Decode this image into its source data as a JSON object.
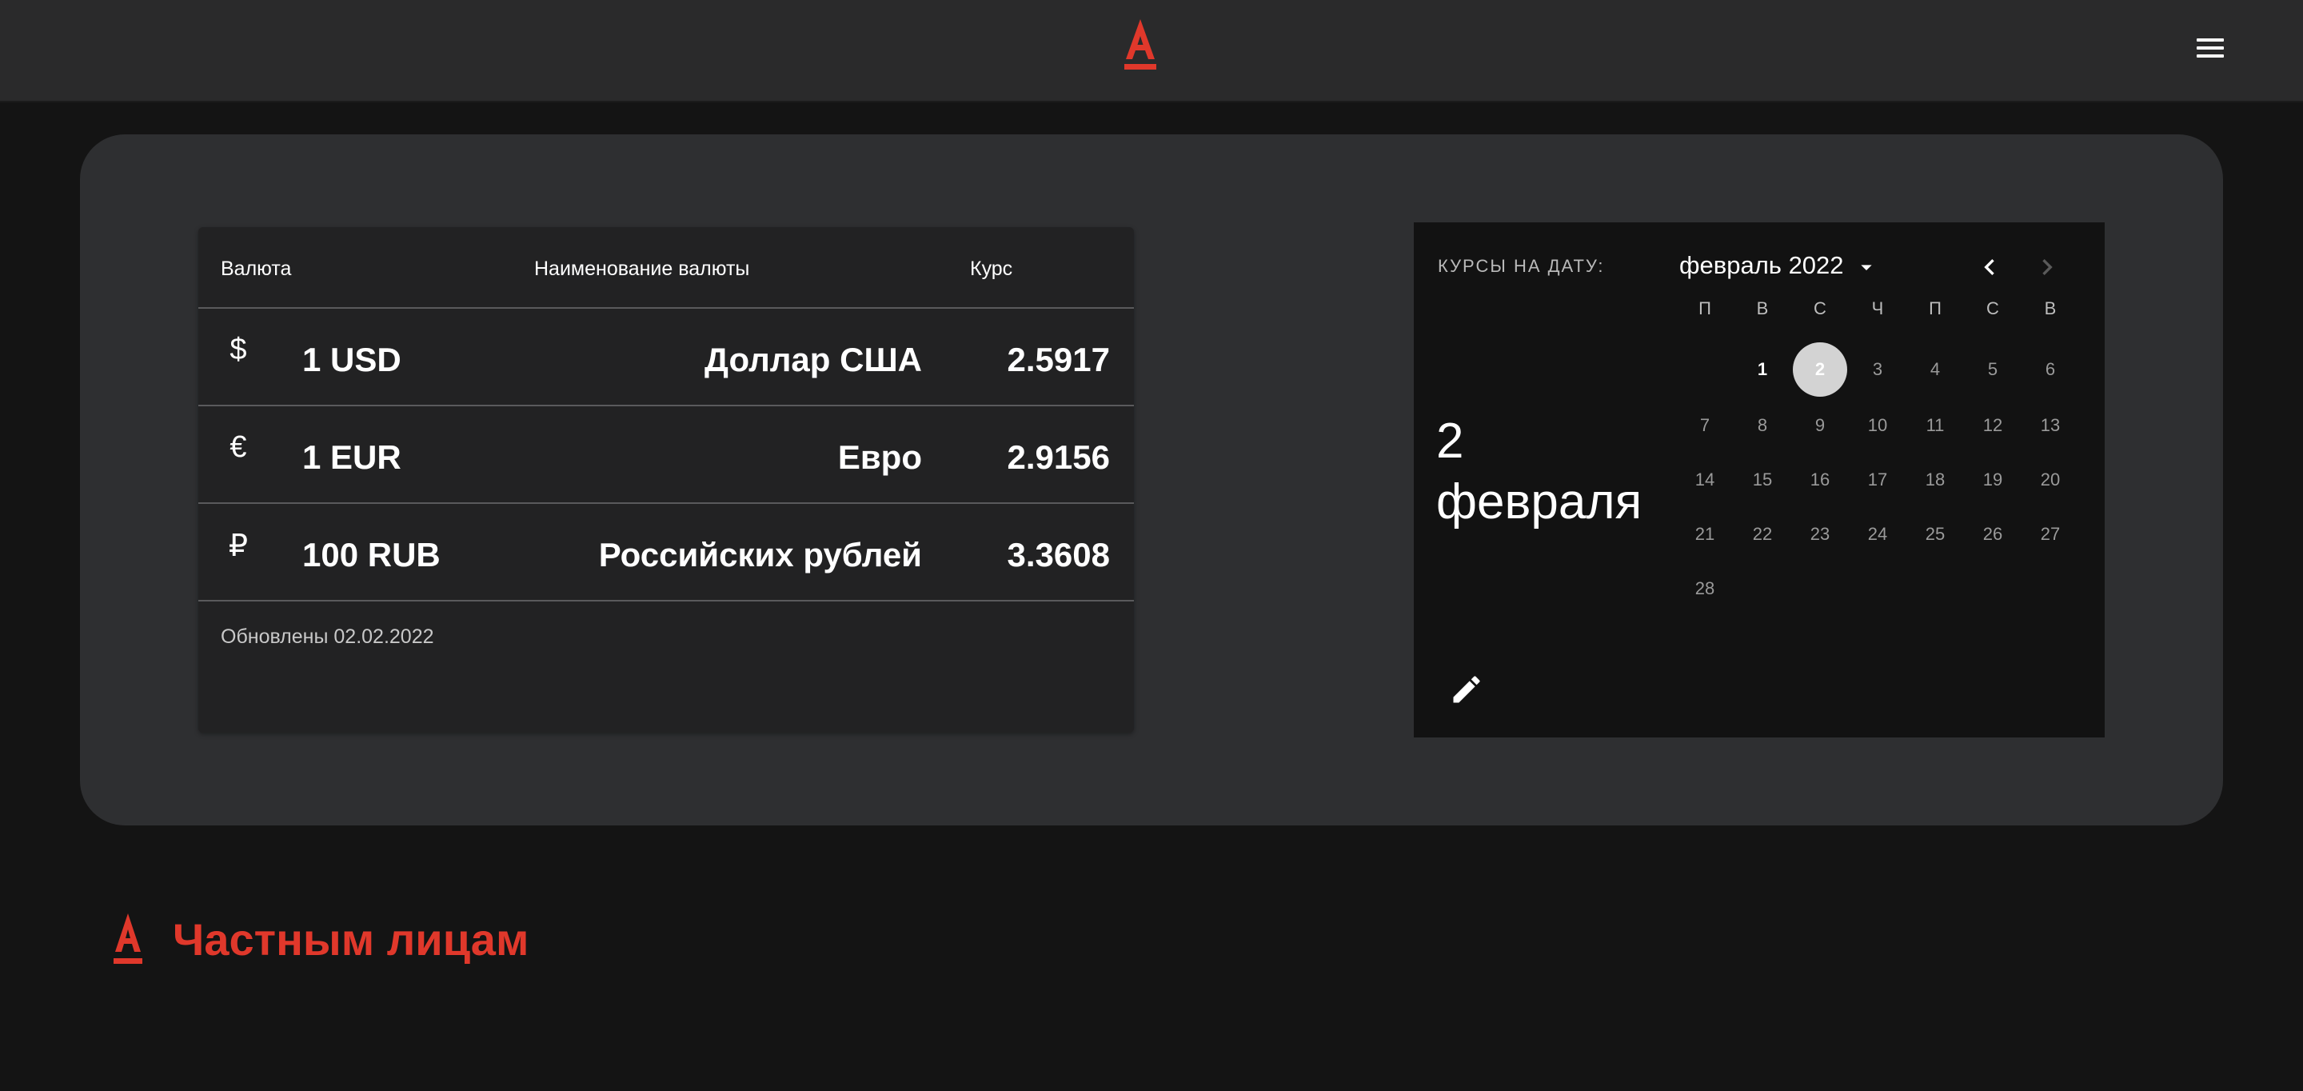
{
  "colors": {
    "brand": "#e0382b",
    "background": "#141414",
    "card": "#2e2f31",
    "table": "#222223",
    "picker": "#121212"
  },
  "header": {
    "logo_icon": "alfa-bank-logo-icon",
    "menu_icon": "hamburger-menu-icon"
  },
  "rates": {
    "headers": {
      "currency": "Валюта",
      "name": "Наименование валюты",
      "rate": "Курс"
    },
    "rows": [
      {
        "symbol": "$",
        "code": "1 USD",
        "name": "Доллар США",
        "value": "2.5917"
      },
      {
        "symbol": "€",
        "code": "1 EUR",
        "name": "Евро",
        "value": "2.9156"
      },
      {
        "symbol": "₽",
        "code": "100 RUB",
        "name": "Российских рублей",
        "value": "3.3608"
      }
    ],
    "updated": "Обновлены 02.02.2022"
  },
  "picker": {
    "label": "КУРСЫ НА ДАТУ:",
    "selected_date": "2 февраля",
    "month": "февраль",
    "year": "2022",
    "edit_icon": "pencil-icon",
    "weekdays": [
      "П",
      "В",
      "С",
      "Ч",
      "П",
      "С",
      "В"
    ],
    "weeks": [
      [
        "",
        "1",
        "2",
        "3",
        "4",
        "5",
        "6"
      ],
      [
        "7",
        "8",
        "9",
        "10",
        "11",
        "12",
        "13"
      ],
      [
        "14",
        "15",
        "16",
        "17",
        "18",
        "19",
        "20"
      ],
      [
        "21",
        "22",
        "23",
        "24",
        "25",
        "26",
        "27"
      ],
      [
        "28",
        "",
        "",
        "",
        "",
        "",
        ""
      ]
    ],
    "today": "1",
    "selected": "2"
  },
  "footer": {
    "title": "Частным лицам",
    "logo_icon": "alfa-bank-logo-icon"
  }
}
